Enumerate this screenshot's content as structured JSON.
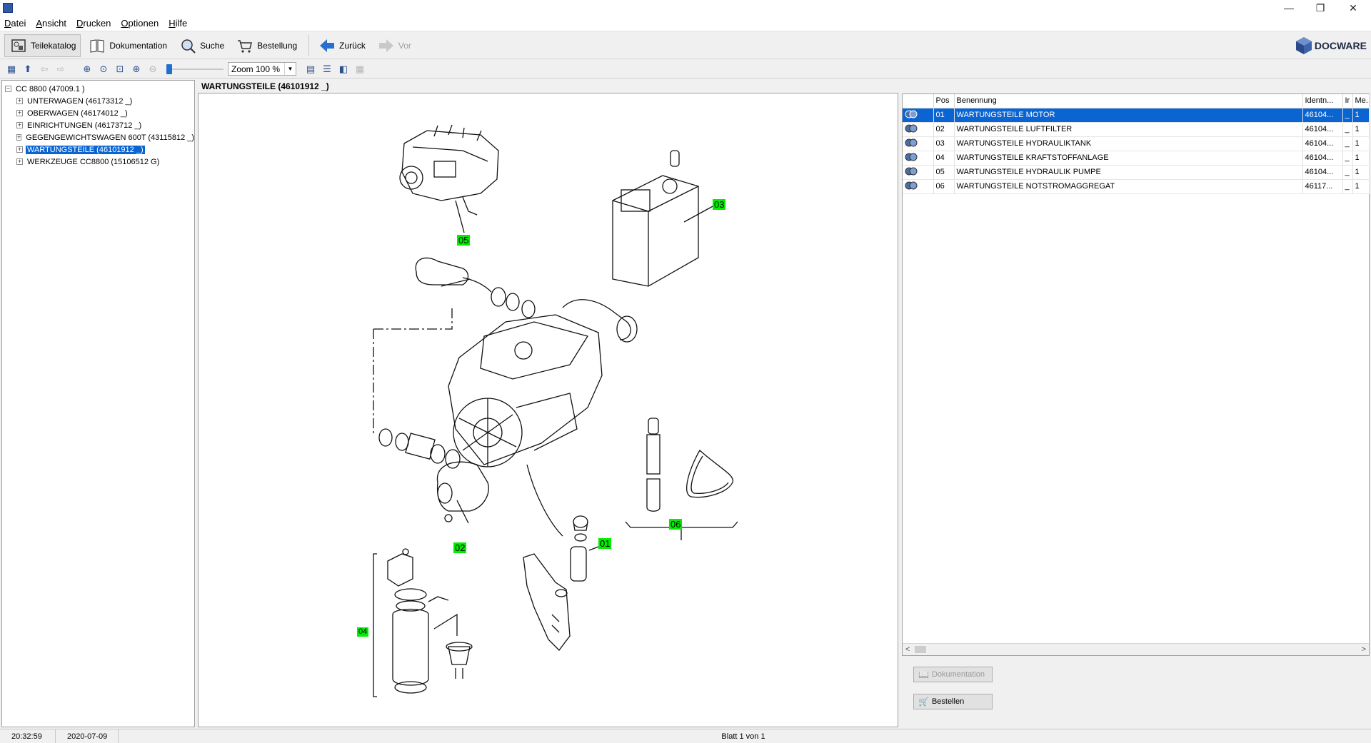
{
  "window": {
    "minimize_glyph": "—",
    "restore_glyph": "❐",
    "close_glyph": "✕"
  },
  "menu": [
    "Datei",
    "Ansicht",
    "Drucken",
    "Optionen",
    "Hilfe"
  ],
  "toolbar": {
    "teilekatalog": "Teilekatalog",
    "dokumentation": "Dokumentation",
    "suche": "Suche",
    "bestellung": "Bestellung",
    "zurueck": "Zurück",
    "vor": "Vor",
    "logo": "DOCWARE"
  },
  "toolbar2": {
    "zoom_value": "Zoom 100 %",
    "zoom_level_percent": 100
  },
  "tree": {
    "root": "CC 8800 (47009.1 )",
    "children": [
      "UNTERWAGEN (46173312 _)",
      "OBERWAGEN (46174012 _)",
      "EINRICHTUNGEN (46173712 _)",
      "GEGENGEWICHTSWAGEN 600T (43115812 _)",
      "WARTUNGSTEILE (46101912 _)",
      "WERKZEUGE CC8800 (15106512 G)"
    ],
    "selected_index": 4
  },
  "drawing": {
    "title": "WARTUNGSTEILE (46101912 _)",
    "labels": [
      "05",
      "03",
      "02",
      "01",
      "06",
      "04"
    ]
  },
  "table": {
    "headers": [
      "",
      "Pos",
      "Benennung",
      "Identn...",
      "Ir",
      "Me..."
    ],
    "rows": [
      {
        "pos": "01",
        "name": "WARTUNGSTEILE MOTOR",
        "ident": "46104...",
        "ir": "_",
        "me": "1"
      },
      {
        "pos": "02",
        "name": "WARTUNGSTEILE LUFTFILTER",
        "ident": "46104...",
        "ir": "_",
        "me": "1"
      },
      {
        "pos": "03",
        "name": "WARTUNGSTEILE HYDRAULIKTANK",
        "ident": "46104...",
        "ir": "_",
        "me": "1"
      },
      {
        "pos": "04",
        "name": "WARTUNGSTEILE KRAFTSTOFFANLAGE",
        "ident": "46104...",
        "ir": "_",
        "me": "1"
      },
      {
        "pos": "05",
        "name": "WARTUNGSTEILE HYDRAULIK PUMPE",
        "ident": "46104...",
        "ir": "_",
        "me": "1"
      },
      {
        "pos": "06",
        "name": "WARTUNGSTEILE NOTSTROMAGGREGAT",
        "ident": "46117...",
        "ir": "_",
        "me": "1"
      }
    ],
    "selected_index": 0,
    "scroll_left": "<",
    "scroll_right": ">"
  },
  "buttons": {
    "dokumentation": "Dokumentation",
    "bestellen": "Bestellen"
  },
  "status": {
    "time": "20:32:59",
    "date": "2020-07-09",
    "page": "Blatt 1 von 1"
  },
  "colors": {
    "selection": "#0a64d2",
    "label_green": "#00ee00"
  }
}
